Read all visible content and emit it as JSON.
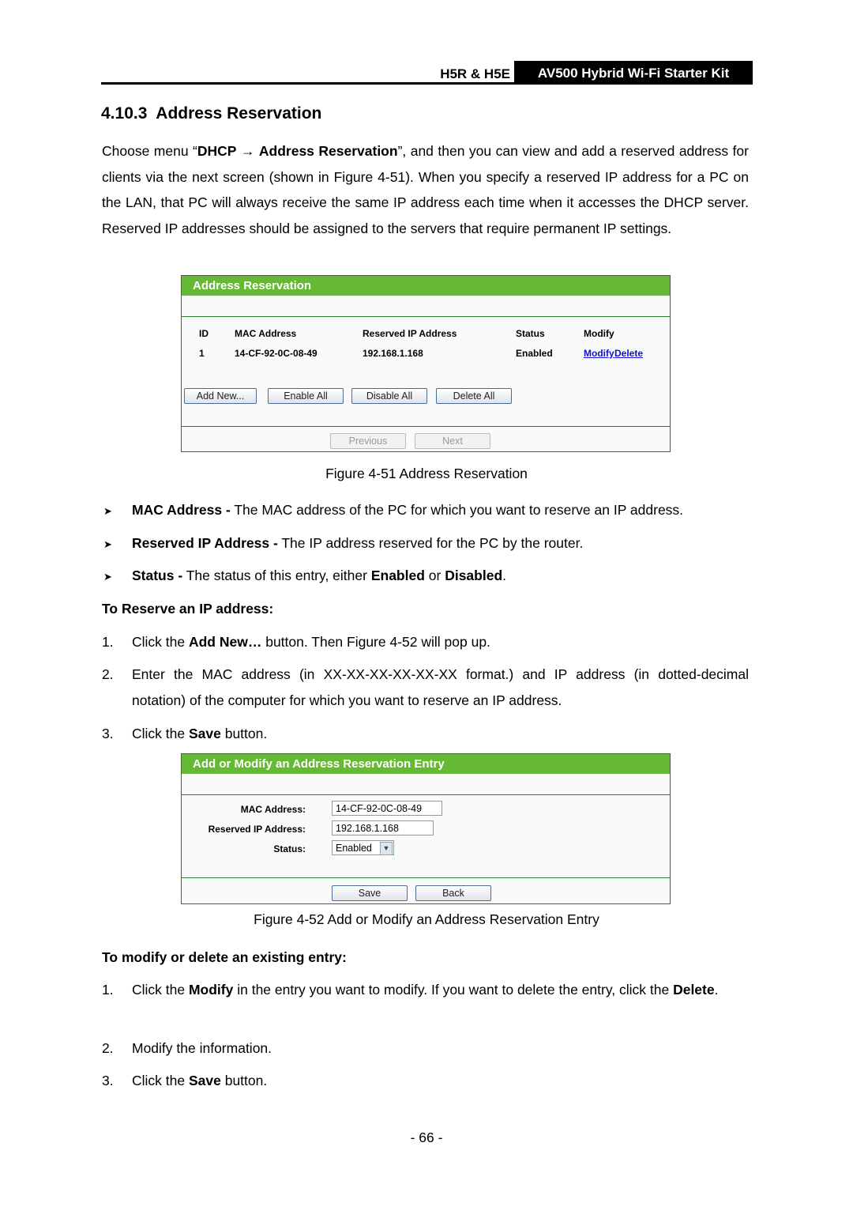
{
  "header": {
    "model": "H5R & H5E",
    "product": "AV500 Hybrid Wi-Fi Starter Kit"
  },
  "section": {
    "number": "4.10.3",
    "title": "Address Reservation"
  },
  "intro": {
    "p1_a": "Choose menu “",
    "p1_menu": "DHCP",
    "p1_arrow": "→",
    "p1_sub": "Address Reservation",
    "p1_b": "”, and then you can view and add a reserved address for clients via the next screen (shown in Figure 4-51). When you specify a reserved IP address for a PC on the LAN, that PC will always receive the same IP address each time when it accesses the DHCP server. Reserved IP addresses should be assigned to the servers that require permanent IP settings."
  },
  "figure1": {
    "title": "Address Reservation",
    "columns": [
      "ID",
      "MAC Address",
      "Reserved IP Address",
      "Status",
      "Modify"
    ],
    "rows": [
      {
        "id": "1",
        "mac": "14-CF-92-0C-08-49",
        "ip": "192.168.1.168",
        "status": "Enabled",
        "modify": "Modify",
        "delete": "Delete"
      }
    ],
    "buttons": {
      "add": "Add New...",
      "enable_all": "Enable All",
      "disable_all": "Disable All",
      "delete_all": "Delete All"
    },
    "nav": {
      "previous": "Previous",
      "next": "Next"
    },
    "caption": "Figure 4-51 Address Reservation"
  },
  "bullets": [
    {
      "term": "MAC Address -",
      "text": " The MAC address of the PC for which you want to reserve an IP address."
    },
    {
      "term": "Reserved IP Address -",
      "text": " The IP address reserved for the PC by the router."
    },
    {
      "term": "Status -",
      "text": " The status of this entry, either ",
      "b1": "Enabled",
      "mid": " or ",
      "b2": "Disabled",
      "end": "."
    }
  ],
  "reserve": {
    "heading": "To Reserve an IP address:",
    "steps": [
      {
        "n": "1.",
        "a": "Click the ",
        "b": "Add New…",
        "c": " button. Then Figure 4-52 will pop up."
      },
      {
        "n": "2.",
        "a": "Enter the MAC address (in XX-XX-XX-XX-XX-XX format.) and IP address (in dotted-decimal notation) of the computer for which you want to reserve an IP address."
      },
      {
        "n": "3.",
        "a": "Click the ",
        "b": "Save",
        "c": " button."
      }
    ]
  },
  "figure2": {
    "title": "Add or Modify an Address Reservation Entry",
    "fields": {
      "mac_label": "MAC Address:",
      "mac_value": "14-CF-92-0C-08-49",
      "ip_label": "Reserved IP Address:",
      "ip_value": "192.168.1.168",
      "status_label": "Status:",
      "status_value": "Enabled"
    },
    "buttons": {
      "save": "Save",
      "back": "Back"
    },
    "caption": "Figure 4-52 Add or Modify an Address Reservation Entry"
  },
  "modify": {
    "heading": "To modify or delete an existing entry:",
    "steps": [
      {
        "n": "1.",
        "a": "Click the ",
        "b": "Modify",
        "c": " in the entry you want to modify. If you want to delete the entry, click the ",
        "d": "Delete",
        "e": "."
      },
      {
        "n": "2.",
        "a": "Modify the information."
      },
      {
        "n": "3.",
        "a": "Click the ",
        "b": "Save",
        "c": " button."
      }
    ]
  },
  "page_number": "- 66 -"
}
